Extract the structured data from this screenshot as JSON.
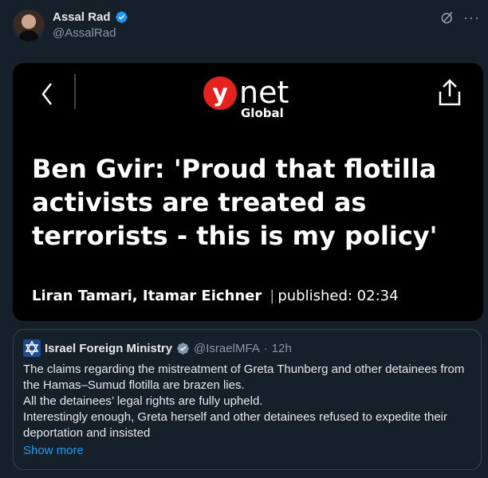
{
  "author": {
    "display_name": "Assal Rad",
    "handle": "@AssalRad"
  },
  "media": {
    "logo_letter": "y",
    "logo_word": "net",
    "logo_sub": "Global",
    "headline": "Ben Gvir: 'Proud that flotilla activists are treated as terrorists - this is my policy'",
    "authors": "Liran Tamari, Itamar Eichner",
    "separator": "|",
    "published": "published: 02:34"
  },
  "quoted": {
    "name": "Israel Foreign Ministry",
    "handle": "@IsraelMFA",
    "dot": "·",
    "time": "12h",
    "lines": [
      "The claims regarding the mistreatment of Greta Thunberg and other detainees from the Hamas–Sumud flotilla are brazen lies.",
      "All the detainees’ legal rights are fully upheld.",
      "Interestingly enough, Greta herself and other detainees refused to expedite their deportation and insisted"
    ],
    "show_more": "Show more"
  },
  "colors": {
    "background": "#15202b",
    "link": "#1d9bf0",
    "verified": "#1d9bf0",
    "ynet_red": "#e4231f"
  }
}
